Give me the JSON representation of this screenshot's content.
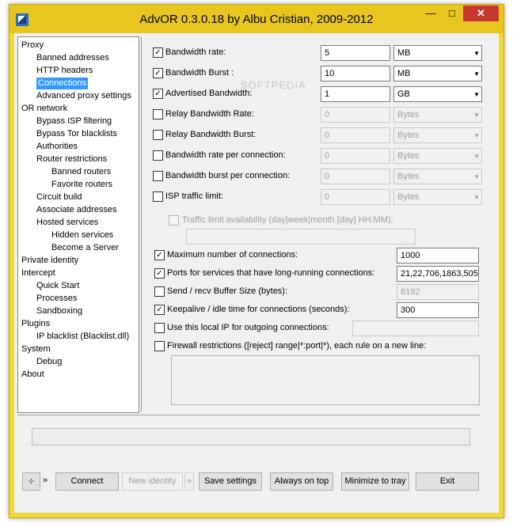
{
  "window": {
    "title": "AdvOR  0.3.0.18 by Albu Cristian, 2009-2012",
    "accent": "#e7c620",
    "close_glyph": "✕",
    "min_glyph": "—",
    "max_glyph": "□"
  },
  "watermark": "SOFTPEDIA",
  "tree": [
    {
      "label": "Proxy",
      "level": 0
    },
    {
      "label": "Banned addresses",
      "level": 1
    },
    {
      "label": "HTTP headers",
      "level": 1
    },
    {
      "label": "Connections",
      "level": 1,
      "selected": true
    },
    {
      "label": "Advanced proxy settings",
      "level": 1
    },
    {
      "label": "OR network",
      "level": 0
    },
    {
      "label": "Bypass ISP filtering",
      "level": 1
    },
    {
      "label": "Bypass Tor blacklists",
      "level": 1
    },
    {
      "label": "Authorities",
      "level": 1
    },
    {
      "label": "Router restrictions",
      "level": 1
    },
    {
      "label": "Banned routers",
      "level": 2
    },
    {
      "label": "Favorite routers",
      "level": 2
    },
    {
      "label": "Circuit build",
      "level": 1
    },
    {
      "label": "Associate addresses",
      "level": 1
    },
    {
      "label": "Hosted services",
      "level": 1
    },
    {
      "label": "Hidden services",
      "level": 2
    },
    {
      "label": "Become a Server",
      "level": 2
    },
    {
      "label": "Private identity",
      "level": 0
    },
    {
      "label": "Intercept",
      "level": 0
    },
    {
      "label": "Quick Start",
      "level": 1
    },
    {
      "label": "Processes",
      "level": 1
    },
    {
      "label": "Sandboxing",
      "level": 1
    },
    {
      "label": "Plugins",
      "level": 0
    },
    {
      "label": "IP blacklist (Blacklist.dll)",
      "level": 1
    },
    {
      "label": "System",
      "level": 0
    },
    {
      "label": "Debug",
      "level": 1
    },
    {
      "label": "About",
      "level": 0
    }
  ],
  "bandwidth": [
    {
      "label": "Bandwidth rate:",
      "checked": true,
      "value": "5",
      "unit": "MB",
      "enabled": true
    },
    {
      "label": "Bandwidth Burst :",
      "checked": true,
      "value": "10",
      "unit": "MB",
      "enabled": true
    },
    {
      "label": "Advertised Bandwidth:",
      "checked": true,
      "value": "1",
      "unit": "GB",
      "enabled": true
    },
    {
      "label": "Relay Bandwidth Rate:",
      "checked": false,
      "value": "0",
      "unit": "Bytes",
      "enabled": false
    },
    {
      "label": "Relay Bandwidth Burst:",
      "checked": false,
      "value": "0",
      "unit": "Bytes",
      "enabled": false
    },
    {
      "label": "Bandwidth rate per connection:",
      "checked": false,
      "value": "0",
      "unit": "Bytes",
      "enabled": false
    },
    {
      "label": "Bandwidth burst per connection:",
      "checked": false,
      "value": "0",
      "unit": "Bytes",
      "enabled": false
    },
    {
      "label": "ISP traffic limit:",
      "checked": false,
      "value": "0",
      "unit": "Bytes",
      "enabled": false
    }
  ],
  "traffic_limit": {
    "label": "Traffic limit availability (day|week|month [day] HH:MM):",
    "checked": false,
    "value": ""
  },
  "connections": [
    {
      "label": "Maximum number of connections:",
      "checked": true,
      "value": "1000",
      "enabled": true
    },
    {
      "label": "Ports for services that have long-running connections:",
      "checked": true,
      "value": "21,22,706,1863,505",
      "enabled": true
    },
    {
      "label": "Send / recv Buffer Size (bytes):",
      "checked": false,
      "value": "8192",
      "enabled": false
    },
    {
      "label": "Keepalive / idle time for connections (seconds):",
      "checked": true,
      "value": "300",
      "enabled": true
    },
    {
      "label": "Use this local IP for outgoing connections:",
      "checked": false,
      "value": "",
      "enabled": false
    }
  ],
  "firewall": {
    "label": "Firewall restrictions ([reject] range|*:port|*), each rule on a new line:",
    "checked": false
  },
  "check_glyph": "✓",
  "dropdown_arrow": "▼",
  "toolbar": {
    "menu_arrow": "»",
    "connect": "Connect",
    "new_identity": "New identity",
    "save_settings": "Save settings",
    "always_on_top": "Always on top",
    "minimize_to_tray": "Minimize to tray",
    "exit": "Exit"
  }
}
